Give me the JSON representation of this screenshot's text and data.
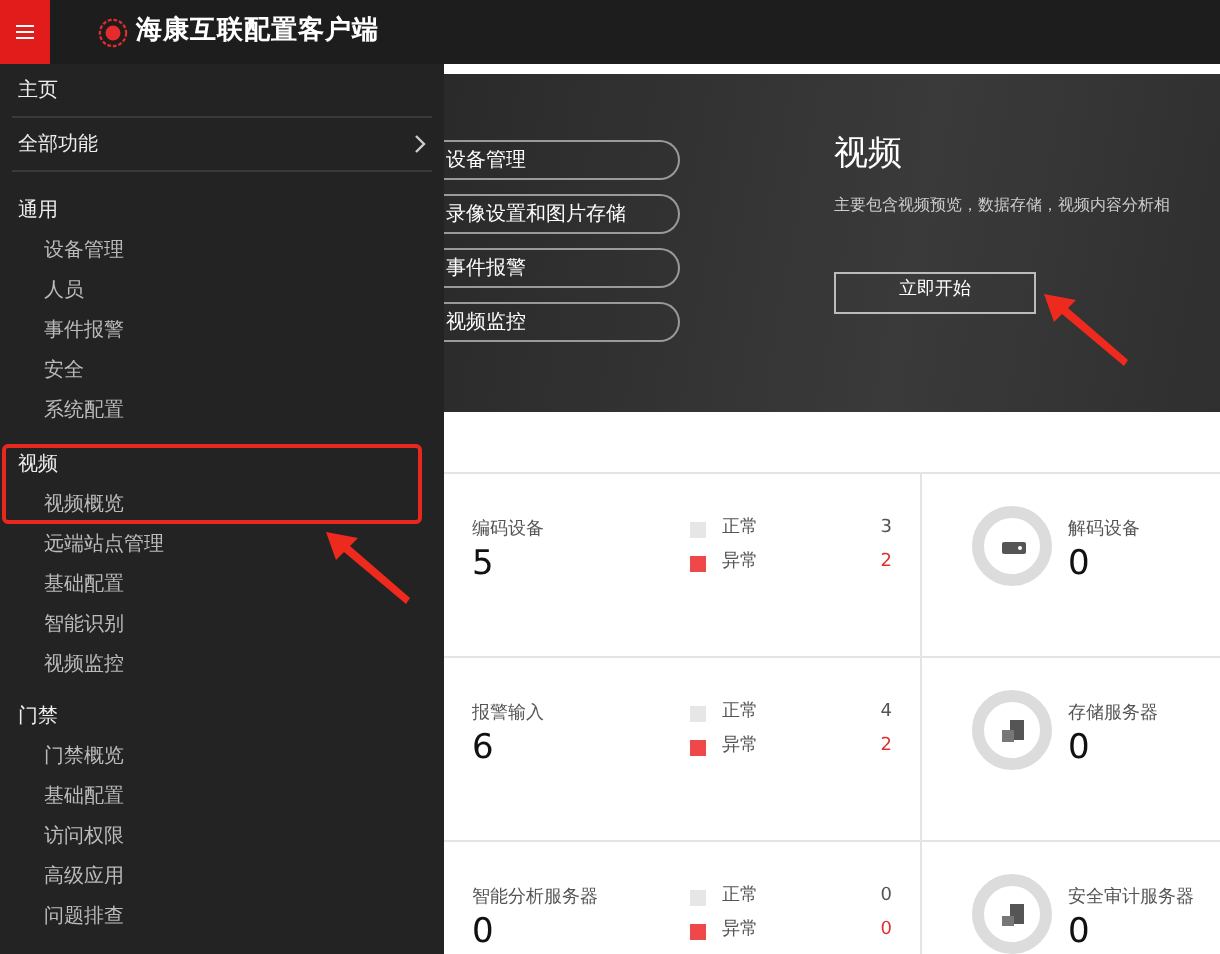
{
  "app": {
    "title": "海康互联配置客户端"
  },
  "menu": {
    "items": [
      {
        "label": "主页",
        "kind": "link"
      },
      {
        "label": "全部功能",
        "kind": "submenu"
      }
    ],
    "groups": [
      {
        "label": "通用",
        "children": [
          {
            "label": "设备管理"
          },
          {
            "label": "人员"
          },
          {
            "label": "事件报警"
          },
          {
            "label": "安全"
          },
          {
            "label": "系统配置"
          }
        ]
      },
      {
        "label": "视频",
        "children": [
          {
            "label": "视频概览"
          },
          {
            "label": "远端站点管理"
          },
          {
            "label": "基础配置"
          },
          {
            "label": "智能识别"
          },
          {
            "label": "视频监控"
          }
        ]
      },
      {
        "label": "门禁",
        "children": [
          {
            "label": "门禁概览"
          },
          {
            "label": "基础配置"
          },
          {
            "label": "访问权限"
          },
          {
            "label": "高级应用"
          },
          {
            "label": "问题排查"
          }
        ]
      }
    ]
  },
  "banner": {
    "steps": [
      "设备管理",
      "录像设置和图片存储",
      "事件报警",
      "视频监控"
    ],
    "title": "视频",
    "description": "主要包含视频预览，数据存储，视频内容分析相",
    "button": "立即开始"
  },
  "stats": [
    {
      "label": "编码设备",
      "value": "5",
      "kind": "split",
      "legend": [
        {
          "label": "正常",
          "count": "3",
          "kind": "normal",
          "color": "#e6e6e6"
        },
        {
          "label": "异常",
          "count": "2",
          "kind": "abnormal",
          "color": "#f04848"
        }
      ]
    },
    {
      "label": "解码设备",
      "value": "0",
      "kind": "single"
    },
    {
      "label": "报警输入",
      "value": "6",
      "kind": "split",
      "legend": [
        {
          "label": "正常",
          "count": "4",
          "kind": "normal",
          "color": "#e6e6e6"
        },
        {
          "label": "异常",
          "count": "2",
          "kind": "abnormal",
          "color": "#f04848"
        }
      ]
    },
    {
      "label": "存储服务器",
      "value": "0",
      "kind": "single"
    },
    {
      "label": "智能分析服务器",
      "value": "0",
      "kind": "split",
      "legend": [
        {
          "label": "正常",
          "count": "0",
          "kind": "normal",
          "color": "#e6e6e6"
        },
        {
          "label": "异常",
          "count": "0",
          "kind": "abnormal",
          "color": "#f04848"
        }
      ]
    },
    {
      "label": "安全审计服务器",
      "value": "0",
      "kind": "single"
    }
  ],
  "annotations": [
    {
      "kind": "highlight-box"
    },
    {
      "kind": "arrow"
    },
    {
      "kind": "arrow"
    }
  ]
}
